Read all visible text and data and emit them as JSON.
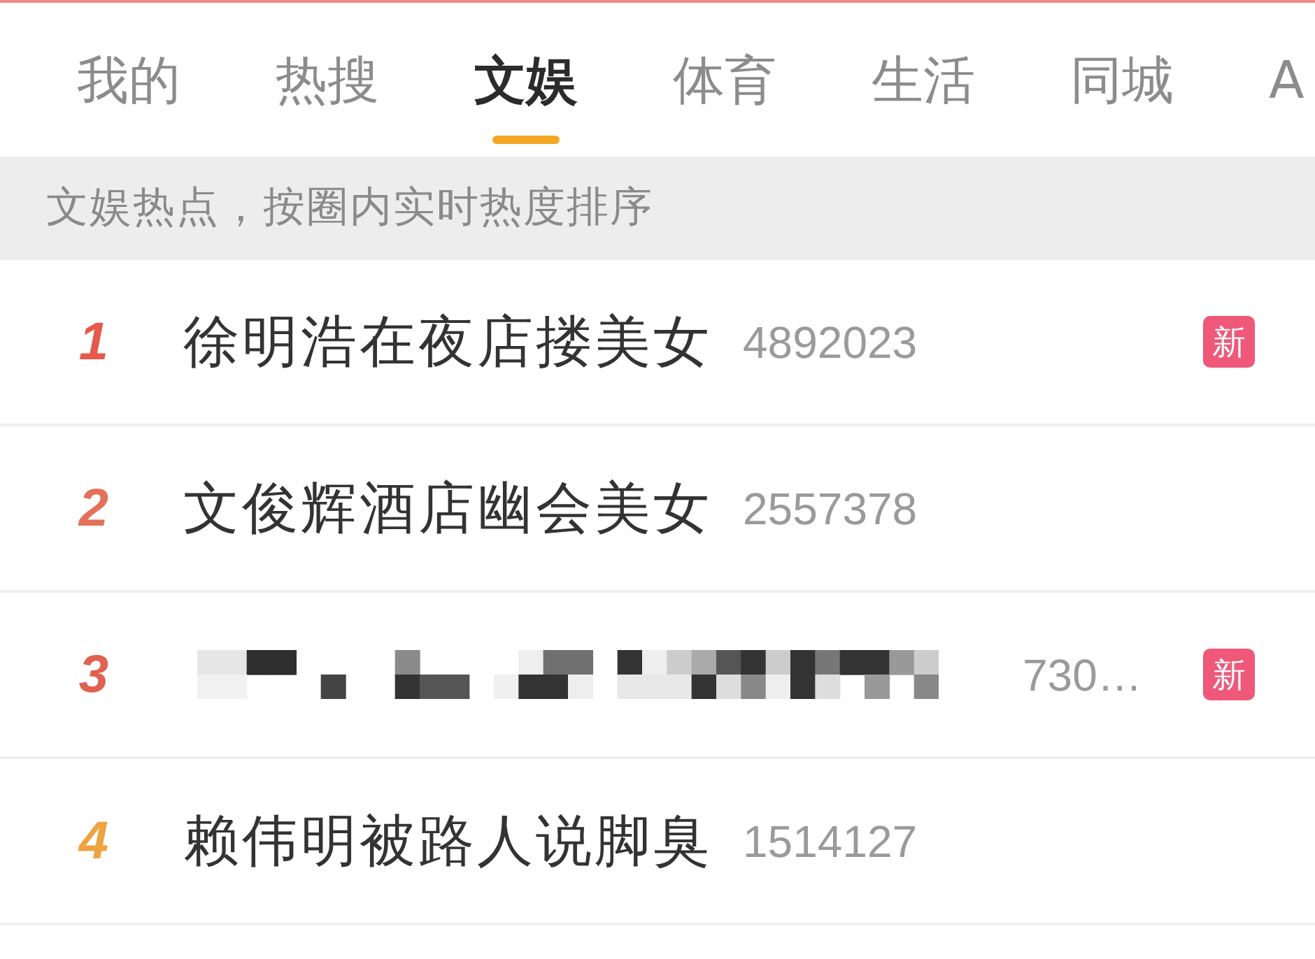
{
  "top_tabs": [
    {
      "label": "我的",
      "selected": false
    },
    {
      "label": "热搜",
      "selected": false
    },
    {
      "label": "文娱",
      "selected": true
    },
    {
      "label": "体育",
      "selected": false
    },
    {
      "label": "生活",
      "selected": false
    },
    {
      "label": "同城",
      "selected": false
    },
    {
      "label": "A",
      "selected": false
    }
  ],
  "banner": {
    "text": "文娱热点，按圈内实时热度排序"
  },
  "hot_list": [
    {
      "kind": "title",
      "rank": "1",
      "color": "#e8594b",
      "title": "徐明浩在夜店搂美女",
      "count": "4892023",
      "badge": "新"
    },
    {
      "kind": "title",
      "rank": "2",
      "color": "#e46f5b",
      "title": "文俊辉酒店幽会美女",
      "count": "2557378"
    },
    {
      "kind": "mosaic",
      "rank": "3",
      "color": "#e3604f",
      "count": "730…",
      "badge": "新"
    },
    {
      "kind": "title",
      "rank": "4",
      "color": "#f0a23c",
      "title": "赖伟明被路人说脚臭",
      "count": "1514127"
    }
  ]
}
